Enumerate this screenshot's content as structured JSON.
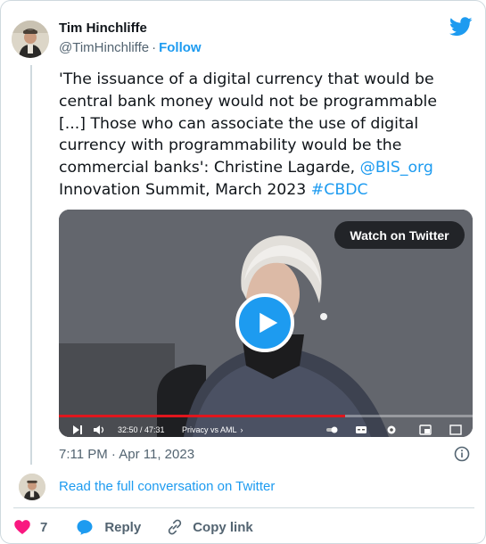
{
  "author": {
    "name": "Tim Hinchliffe",
    "handle": "@TimHinchliffe",
    "separator": "·",
    "follow_label": "Follow"
  },
  "tweet": {
    "text_before": "'The issuance of a digital currency that would be central bank money would not be programmable [...] Those who can associate the use of digital currency with programmability would be the commercial banks': Christine Lagarde, ",
    "mention": "@BIS_org",
    "text_after": " Innovation Summit, March 2023 ",
    "hashtag": "#CBDC"
  },
  "video": {
    "watch_label": "Watch on Twitter",
    "time_display": "32:50 / 47:31",
    "privacy_label": "Privacy vs AML",
    "progress_fraction": 0.691
  },
  "timestamp": "7:11 PM · Apr 11, 2023",
  "read_full_label": "Read the full conversation on Twitter",
  "actions": {
    "like_count": "7",
    "reply_label": "Reply",
    "copy_label": "Copy link"
  },
  "colors": {
    "brand_blue": "#1d9bf0",
    "like_pink": "#f91880",
    "progress_red": "#e0161d",
    "text_secondary": "#536471"
  },
  "icons": [
    "twitter-bird-icon",
    "play-icon",
    "info-icon",
    "heart-icon",
    "reply-icon",
    "link-icon"
  ]
}
